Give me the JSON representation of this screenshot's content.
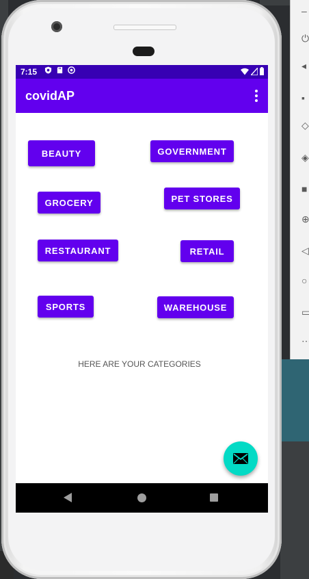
{
  "status_bar": {
    "time": "7:15",
    "icons_left": [
      "shield-notification-icon",
      "sd-card-icon",
      "sync-icon"
    ],
    "icons_right": [
      "wifi-icon",
      "signal-icon",
      "battery-icon"
    ]
  },
  "app_bar": {
    "title": "covidAP",
    "menu_icon": "overflow-menu-icon"
  },
  "categories": {
    "beauty": "BEAUTY",
    "government": "GOVERNMENT",
    "grocery": "GROCERY",
    "pet_stores": "PET STORES",
    "restaurant": "RESTAURANT",
    "retail": "RETAIL",
    "sports": "SPORTS",
    "warehouse": "WAREHOUSE"
  },
  "message": "HERE ARE YOUR CATEGORIES",
  "fab": {
    "icon": "email-icon"
  },
  "nav_bar": {
    "back_icon": "back-icon",
    "home_icon": "home-icon",
    "recents_icon": "recents-icon"
  },
  "colors": {
    "primary": "#6200ee",
    "primary_dark": "#3700b3",
    "accent": "#03dac5",
    "nav_bar": "#000000"
  }
}
